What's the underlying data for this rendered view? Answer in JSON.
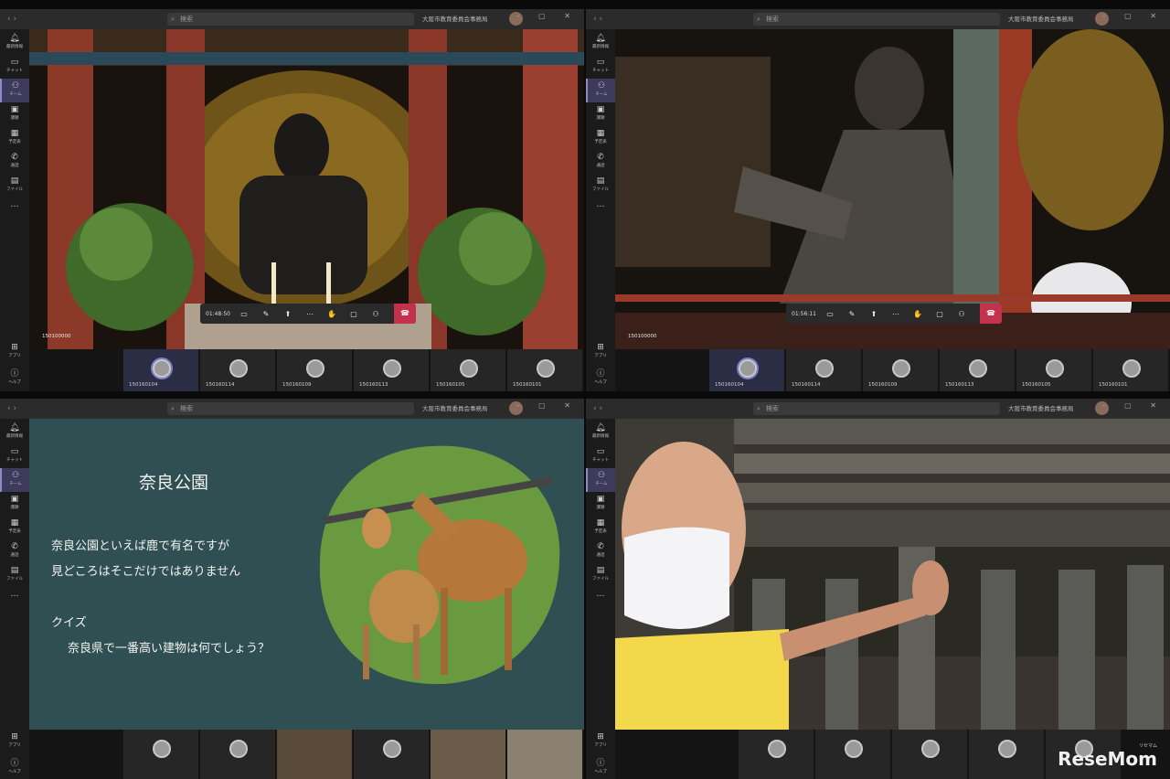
{
  "window": {
    "search_placeholder": "検索",
    "org_name": "大阪市教育委員会事務局",
    "window_controls": "– ▢ ✕"
  },
  "rail_items": [
    {
      "icon": "bell-icon",
      "label": "最新情報"
    },
    {
      "icon": "chat-icon",
      "label": "チャット"
    },
    {
      "icon": "teams-icon",
      "label": "チーム"
    },
    {
      "icon": "assignments-icon",
      "label": "課題"
    },
    {
      "icon": "calendar-icon",
      "label": "予定表"
    },
    {
      "icon": "call-icon",
      "label": "通話"
    },
    {
      "icon": "files-icon",
      "label": "ファイル"
    },
    {
      "icon": "more-icon",
      "label": "…"
    }
  ],
  "rail_bottom": [
    {
      "icon": "apps-icon",
      "label": "アプリ"
    },
    {
      "icon": "help-icon",
      "label": "ヘルプ"
    }
  ],
  "pane1": {
    "self_name": "150100000",
    "call_time": "01:48:50",
    "participants": [
      "150160104",
      "150160114",
      "150160109",
      "150160113",
      "150160105",
      "150160101"
    ]
  },
  "pane2": {
    "self_name": "150100000",
    "call_time": "01:56:11",
    "participants": [
      "150160104",
      "150160114",
      "150160109",
      "150160113",
      "150160105",
      "150160101"
    ]
  },
  "slide": {
    "title": "奈良公園",
    "line1": "奈良公園といえば鹿で有名ですが",
    "line2": "見どころはそこだけではありません",
    "line3": "クイズ",
    "line4": "奈良県で一番高い建物は何でしょう？"
  },
  "watermark": {
    "text": "ReseMom",
    "sub": "リセマム"
  }
}
